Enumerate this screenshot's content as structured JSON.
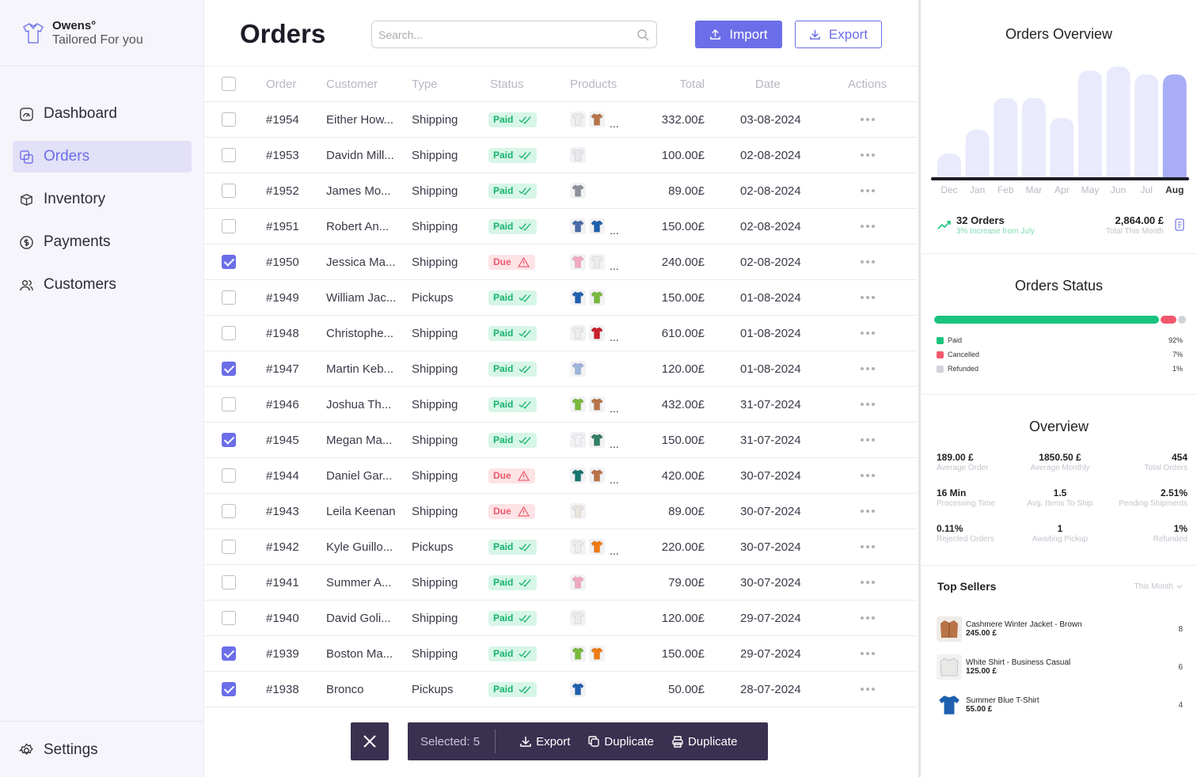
{
  "brand": {
    "name": "Owens°",
    "tagline": "Tailored For you"
  },
  "nav": {
    "items": [
      {
        "label": "Dashboard"
      },
      {
        "label": "Orders"
      },
      {
        "label": "Inventory"
      },
      {
        "label": "Payments"
      },
      {
        "label": "Customers"
      }
    ],
    "settings": "Settings"
  },
  "header": {
    "title": "Orders",
    "search_placeholder": "Search...",
    "import_label": "Import",
    "export_label": "Export"
  },
  "table": {
    "columns": [
      "Order",
      "Customer",
      "Type",
      "Status",
      "Products",
      "Total",
      "Date",
      "Actions"
    ],
    "rows": [
      {
        "checked": false,
        "order": "#1954",
        "customer": "Either How...",
        "type": "Shipping",
        "status": "Paid",
        "products": [
          "white-shirt",
          "brown-jacket"
        ],
        "more": "...",
        "total": "332.00£",
        "date": "03-08-2024"
      },
      {
        "checked": false,
        "order": "#1953",
        "customer": "Davidn Mill...",
        "type": "Shipping",
        "status": "Paid",
        "products": [
          "white-shirt-model"
        ],
        "more": "",
        "total": "100.00£",
        "date": "02-08-2024"
      },
      {
        "checked": false,
        "order": "#1952",
        "customer": "James Mo...",
        "type": "Shipping",
        "status": "Paid",
        "products": [
          "grey-shirt-model"
        ],
        "more": "",
        "total": "89.00£",
        "date": "02-08-2024"
      },
      {
        "checked": false,
        "order": "#1951",
        "customer": "Robert An...",
        "type": "Shipping",
        "status": "Paid",
        "products": [
          "denim-shirt",
          "blue-tshirt"
        ],
        "more": "...",
        "total": "150.00£",
        "date": "02-08-2024"
      },
      {
        "checked": true,
        "order": "#1950",
        "customer": "Jessica Ma...",
        "type": "Shipping",
        "status": "Due",
        "products": [
          "pink-shirt",
          "white-shirt"
        ],
        "more": "...",
        "total": "240.00£",
        "date": "02-08-2024"
      },
      {
        "checked": false,
        "order": "#1949",
        "customer": "William Jac...",
        "type": "Pickups",
        "status": "Paid",
        "products": [
          "blue-tshirt",
          "green-tshirt"
        ],
        "more": "",
        "total": "150.00£",
        "date": "01-08-2024"
      },
      {
        "checked": false,
        "order": "#1948",
        "customer": "Christophe...",
        "type": "Shipping",
        "status": "Paid",
        "products": [
          "white-shirt",
          "red-tshirt"
        ],
        "more": "...",
        "total": "610.00£",
        "date": "01-08-2024"
      },
      {
        "checked": true,
        "order": "#1947",
        "customer": "Martin Keb...",
        "type": "Shipping",
        "status": "Paid",
        "products": [
          "light-blue-shirt"
        ],
        "more": "",
        "total": "120.00£",
        "date": "01-08-2024"
      },
      {
        "checked": false,
        "order": "#1946",
        "customer": "Joshua Th...",
        "type": "Shipping",
        "status": "Paid",
        "products": [
          "green-tshirt",
          "brown-jacket"
        ],
        "more": "...",
        "total": "432.00£",
        "date": "31-07-2024"
      },
      {
        "checked": true,
        "order": "#1945",
        "customer": "Megan Ma...",
        "type": "Shipping",
        "status": "Paid",
        "products": [
          "white-tshirt",
          "green-model"
        ],
        "more": "...",
        "total": "150.00£",
        "date": "31-07-2024"
      },
      {
        "checked": false,
        "order": "#1944",
        "customer": "Daniel Gar...",
        "type": "Shipping",
        "status": "Due",
        "products": [
          "teal-tshirt",
          "brown-jacket"
        ],
        "more": "...",
        "total": "420.00£",
        "date": "30-07-2024"
      },
      {
        "checked": false,
        "order": "#1943",
        "customer": "Leila Keenan",
        "type": "Shipping",
        "status": "Due",
        "products": [
          "white-model"
        ],
        "more": "",
        "total": "89.00£",
        "date": "30-07-2024"
      },
      {
        "checked": false,
        "order": "#1942",
        "customer": "Kyle Guillo...",
        "type": "Pickups",
        "status": "Paid",
        "products": [
          "white-shirt",
          "orange-tshirt"
        ],
        "more": "...",
        "total": "220.00£",
        "date": "30-07-2024"
      },
      {
        "checked": false,
        "order": "#1941",
        "customer": "Summer A...",
        "type": "Shipping",
        "status": "Paid",
        "products": [
          "pink-shirt"
        ],
        "more": "",
        "total": "79.00£",
        "date": "30-07-2024"
      },
      {
        "checked": false,
        "order": "#1940",
        "customer": "David Goli...",
        "type": "Shipping",
        "status": "Paid",
        "products": [
          "white-shirt"
        ],
        "more": "",
        "total": "120.00£",
        "date": "29-07-2024"
      },
      {
        "checked": true,
        "order": "#1939",
        "customer": "Boston Ma...",
        "type": "Shipping",
        "status": "Paid",
        "products": [
          "green-tshirt",
          "orange-tshirt"
        ],
        "more": "",
        "total": "150.00£",
        "date": "29-07-2024"
      },
      {
        "checked": true,
        "order": "#1938",
        "customer": "Bronco",
        "type": "Pickups",
        "status": "Paid",
        "products": [
          "blue-tshirt"
        ],
        "more": "",
        "total": "50.00£",
        "date": "28-07-2024"
      }
    ]
  },
  "bulk": {
    "selected": "Selected: 5",
    "export": "Export",
    "duplicate1": "Duplicate",
    "duplicate2": "Duplicate"
  },
  "overview": {
    "title": "Orders Overview",
    "orders": "32 Orders",
    "growth": "3% Increase from July",
    "total": "2,864.00 £",
    "total_label": "Total This Month"
  },
  "chart_data": {
    "type": "bar",
    "categories": [
      "Dec",
      "Jan",
      "Feb",
      "Mar",
      "Apr",
      "May",
      "Jun",
      "Jul",
      "Aug"
    ],
    "values": [
      6,
      12,
      20,
      20,
      15,
      27,
      28,
      26,
      26
    ],
    "highlight": "Aug"
  },
  "status": {
    "title": "Orders Status",
    "items": [
      {
        "label": "Paid",
        "value": "92%",
        "color": "#19c37d"
      },
      {
        "label": "Cancelled",
        "value": "7%",
        "color": "#f2586c"
      },
      {
        "label": "Refunded",
        "value": "1%",
        "color": "#d2d2da"
      }
    ]
  },
  "ov2": {
    "title": "Overview",
    "stats": [
      {
        "v": "189.00 £",
        "l": "Average Order"
      },
      {
        "v": "1850.50 £",
        "l": "Average Monthly"
      },
      {
        "v": "454",
        "l": "Total Orders"
      },
      {
        "v": "16 Min",
        "l": "Processing Time"
      },
      {
        "v": "1.5",
        "l": "Avg. Items To Ship"
      },
      {
        "v": "2.51%",
        "l": "Pending Shipments"
      },
      {
        "v": "0.11%",
        "l": "Rejected Orders"
      },
      {
        "v": "1",
        "l": "Awaiting Pickup"
      },
      {
        "v": "1%",
        "l": "Refunded"
      }
    ]
  },
  "sellers": {
    "title": "Top Sellers",
    "filter": "This Month",
    "items": [
      {
        "name": "Cashmere Winter Jacket - Brown",
        "price": "245.00 £",
        "qty": "8"
      },
      {
        "name": "White Shirt - Business Casual",
        "price": "125.00 £",
        "qty": "6"
      },
      {
        "name": "Summer Blue T-Shirt",
        "price": "55.00 £",
        "qty": "4"
      }
    ]
  }
}
